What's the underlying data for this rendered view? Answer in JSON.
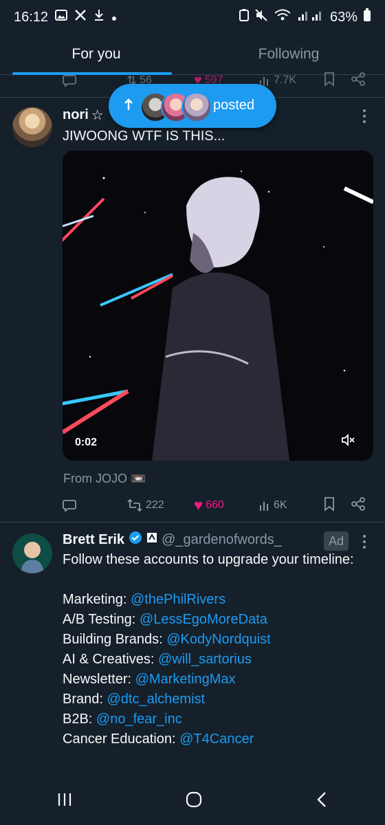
{
  "status_bar": {
    "time": "16:12",
    "battery": "63%"
  },
  "tabs": [
    {
      "label": "For you"
    },
    {
      "label": "Following"
    }
  ],
  "prev_post": {
    "retweets": "56",
    "likes": "597",
    "views": "7.7K"
  },
  "new_posts_pill": {
    "label": "posted"
  },
  "post1": {
    "author_name": "nori",
    "author_badge": "☆",
    "text": "JIWOONG WTF IS THIS...",
    "video_time": "0:02",
    "caption": "From JOJO 📼",
    "retweets": "222",
    "likes": "660",
    "views": "6K"
  },
  "post2": {
    "author_name": "Brett Erik",
    "handle": "@_gardenofwords_",
    "ad_label": "Ad",
    "intro": "Follow these accounts to upgrade your timeline:",
    "lines": [
      {
        "label": "Marketing:",
        "handle": "@thePhilRivers"
      },
      {
        "label": "A/B Testing:",
        "handle": "@LessEgoMoreData"
      },
      {
        "label": "Building Brands:",
        "handle": "@KodyNordquist"
      },
      {
        "label": "AI & Creatives:",
        "handle": "@will_sartorius"
      },
      {
        "label": "Newsletter:",
        "handle": "@MarketingMax"
      },
      {
        "label": "Brand:",
        "handle": "@dtc_alchemist"
      },
      {
        "label": "B2B:",
        "handle": "@no_fear_inc"
      },
      {
        "label": "Cancer Education:",
        "handle": "@T4Cancer"
      }
    ]
  },
  "colors": {
    "background": "#15202b",
    "accent": "#1d9bf0",
    "like": "#f91880",
    "muted": "#8b98a5"
  }
}
